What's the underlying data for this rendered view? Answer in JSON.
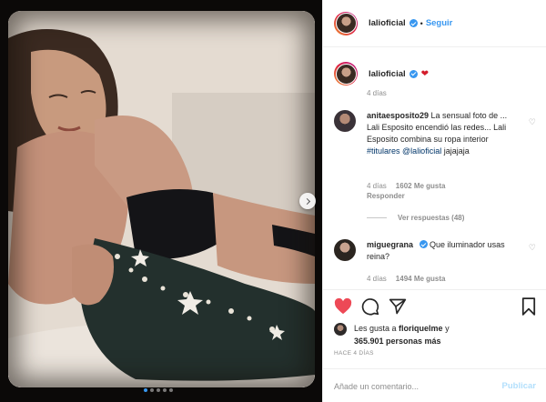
{
  "post": {
    "image_alt": "Photo post",
    "carousel_pages": 5,
    "carousel_current": 0
  },
  "header": {
    "username": "lalioficial",
    "separator": "•",
    "follow_label": "Seguir"
  },
  "caption": {
    "username": "lalioficial",
    "emoji": "❤",
    "time": "4 días"
  },
  "comments": [
    {
      "username": "anitaesposito29",
      "text_before": "La sensual foto de ... Lali Esposito encendió las redes... Lali Esposito combina su ropa interior ",
      "hashtag": "#titulares",
      "mention": "@lalioficial",
      "text_after": "jajajaja",
      "time": "4 días",
      "likes": "1602 Me gusta",
      "reply_label": "Responder",
      "view_replies": "Ver respuestas (48)"
    },
    {
      "username": "miguegrana",
      "text": "Que iluminador usas reina?",
      "time": "4 días",
      "likes": "1494 Me gusta"
    }
  ],
  "actions": {
    "like_icon": "heart-filled-icon",
    "comment_icon": "comment-bubble-icon",
    "share_icon": "paper-plane-icon",
    "save_icon": "bookmark-icon",
    "like_color": "#ed4956"
  },
  "likes": {
    "prefix": "Les gusta a ",
    "user": "floriquelme",
    "conjunction": " y",
    "count": "365.901 personas más"
  },
  "timestamp": "HACE 4 DÍAS",
  "comment_input": {
    "placeholder": "Añade un comentario...",
    "post_label": "Publicar"
  },
  "colors": {
    "link_blue": "#3897f0",
    "post_disabled": "#b2dffc",
    "muted": "#8e8e8e"
  }
}
